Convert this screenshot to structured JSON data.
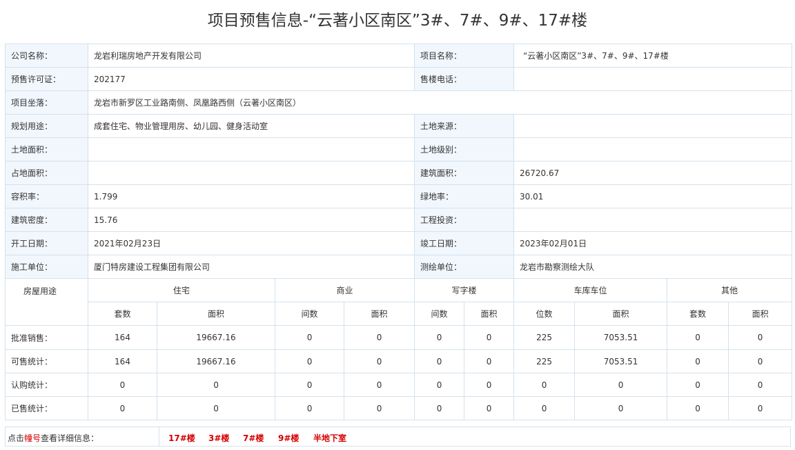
{
  "page_title": "项目预售信息-“云著小区南区”3#、7#、9#、17#楼",
  "info": {
    "company_label": "公司名称：",
    "company": "龙岩利瑞房地产开发有限公司",
    "project_name_label": "项目名称：",
    "project_name": "“云著小区南区”3#、7#、9#、17#楼",
    "permit_label": "预售许可证：",
    "permit": "202177",
    "phone_label": "售楼电话：",
    "phone": "",
    "location_label": "项目坐落：",
    "location": "龙岩市新罗区工业路南侧、凤凰路西侧（云著小区南区）",
    "usage_label": "规划用途：",
    "usage": "成套住宅、物业管理用房、幼儿园、健身活动室",
    "land_source_label": "土地来源：",
    "land_source": "",
    "land_area_label": "土地面积：",
    "land_area": "",
    "land_grade_label": "土地级别：",
    "land_grade": "",
    "occupied_area_label": "占地面积：",
    "occupied_area": "",
    "building_area_label": "建筑面积：",
    "building_area": "26720.67",
    "plot_ratio_label": "容积率：",
    "plot_ratio": "1.799",
    "green_rate_label": "绿地率：",
    "green_rate": "30.01",
    "building_density_label": "建筑密度：",
    "building_density": "15.76",
    "investment_label": "工程投资：",
    "investment": "",
    "start_date_label": "开工日期：",
    "start_date": "2021年02月23日",
    "end_date_label": "竣工日期：",
    "end_date": "2023年02月01日",
    "contractor_label": "施工单位：",
    "contractor": "厦门特房建设工程集团有限公司",
    "surveyor_label": "测绘单位：",
    "surveyor": "龙岩市勘察测绘大队"
  },
  "stats": {
    "usage_header": "房屋用途",
    "groups": [
      "住宅",
      "商业",
      "写字楼",
      "车库车位",
      "其他"
    ],
    "subheaders": [
      "套数",
      "面积",
      "间数",
      "面积",
      "间数",
      "面积",
      "位数",
      "面积",
      "套数",
      "面积"
    ],
    "rows": [
      {
        "label": "批准销售：",
        "values": [
          "164",
          "19667.16",
          "0",
          "0",
          "0",
          "0",
          "225",
          "7053.51",
          "0",
          "0"
        ]
      },
      {
        "label": "可售统计：",
        "values": [
          "164",
          "19667.16",
          "0",
          "0",
          "0",
          "0",
          "225",
          "7053.51",
          "0",
          "0"
        ]
      },
      {
        "label": "认购统计：",
        "values": [
          "0",
          "0",
          "0",
          "0",
          "0",
          "0",
          "0",
          "0",
          "0",
          "0"
        ]
      },
      {
        "label": "已售统计：",
        "values": [
          "0",
          "0",
          "0",
          "0",
          "0",
          "0",
          "0",
          "0",
          "0",
          "0"
        ]
      }
    ]
  },
  "footer": {
    "lead_prefix": "点击",
    "lead_highlight": "幢号",
    "lead_suffix": "查看详细信息：",
    "buildings": [
      "17#楼",
      "3#楼",
      "7#楼",
      "9#楼",
      "半地下室"
    ]
  },
  "colors": {
    "border": "#d4e1ec",
    "label_bg": "#f1f7fd",
    "link_red": "#d40000"
  }
}
